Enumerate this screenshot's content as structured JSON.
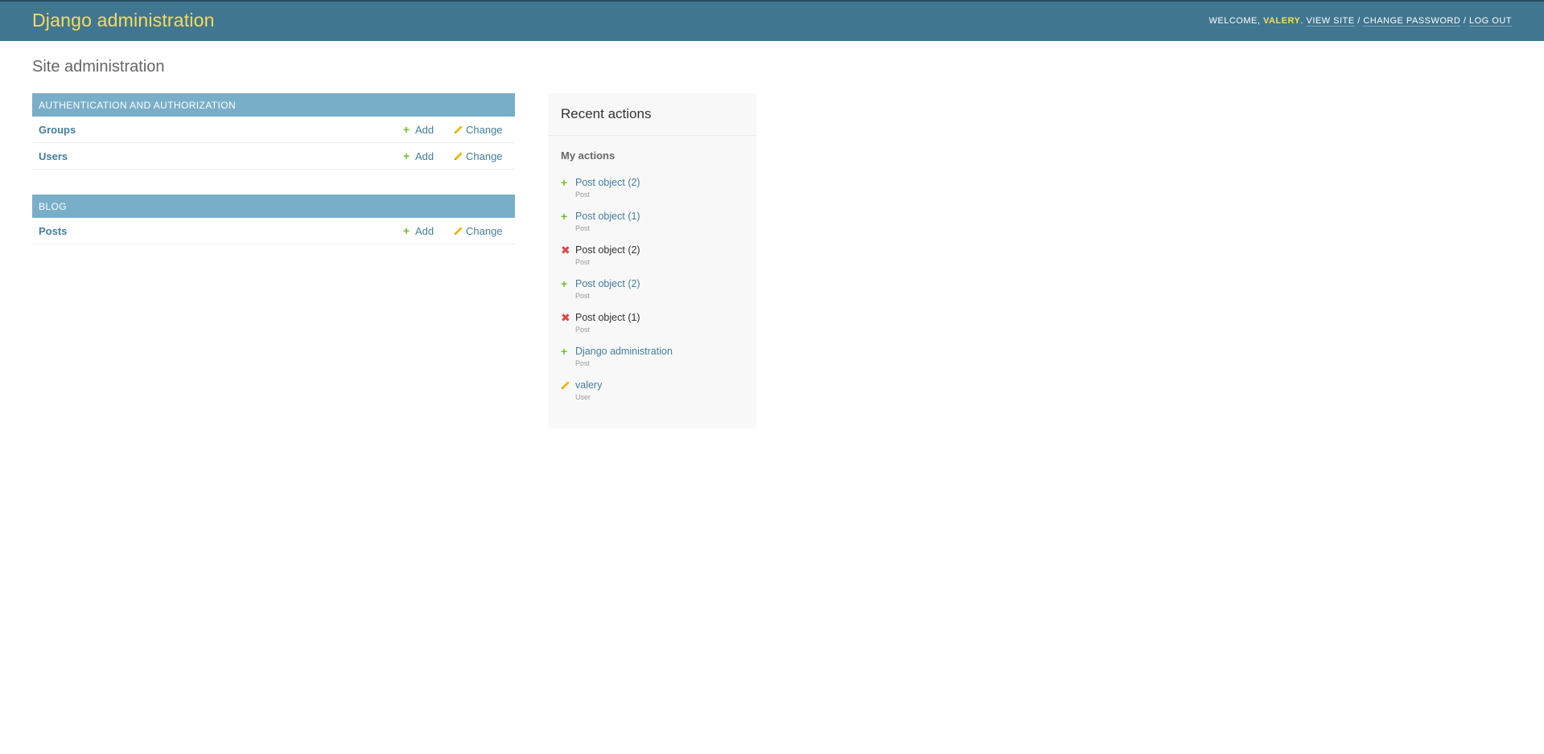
{
  "header": {
    "brand": "Django administration",
    "welcome": "Welcome,",
    "username": "valery",
    "view_site": "View site",
    "change_password": "Change password",
    "log_out": "Log out",
    "separator": "/"
  },
  "page": {
    "title": "Site administration"
  },
  "modules": [
    {
      "caption": "Authentication and Authorization",
      "models": [
        {
          "name": "Groups",
          "add": "Add",
          "change": "Change"
        },
        {
          "name": "Users",
          "add": "Add",
          "change": "Change"
        }
      ]
    },
    {
      "caption": "Blog",
      "models": [
        {
          "name": "Posts",
          "add": "Add",
          "change": "Change"
        }
      ]
    }
  ],
  "recent_actions": {
    "title": "Recent actions",
    "subtitle": "My actions",
    "items": [
      {
        "icon": "add-icon",
        "label": "Post object (2)",
        "type": "Post"
      },
      {
        "icon": "add-icon",
        "label": "Post object (1)",
        "type": "Post"
      },
      {
        "icon": "delete-icon",
        "label": "Post object (2)",
        "type": "Post"
      },
      {
        "icon": "add-icon",
        "label": "Post object (2)",
        "type": "Post"
      },
      {
        "icon": "delete-icon",
        "label": "Post object (1)",
        "type": "Post"
      },
      {
        "icon": "add-icon",
        "label": "Django administration",
        "type": "Post"
      },
      {
        "icon": "change-icon",
        "label": "valery",
        "type": "User"
      }
    ]
  },
  "colors": {
    "header_bg": "#417690",
    "brand": "#f5dd5d",
    "caption_bg": "#79aec8",
    "link": "#447e9b",
    "add": "#70bf2b",
    "delete": "#dd4646",
    "change": "#efb80b"
  }
}
